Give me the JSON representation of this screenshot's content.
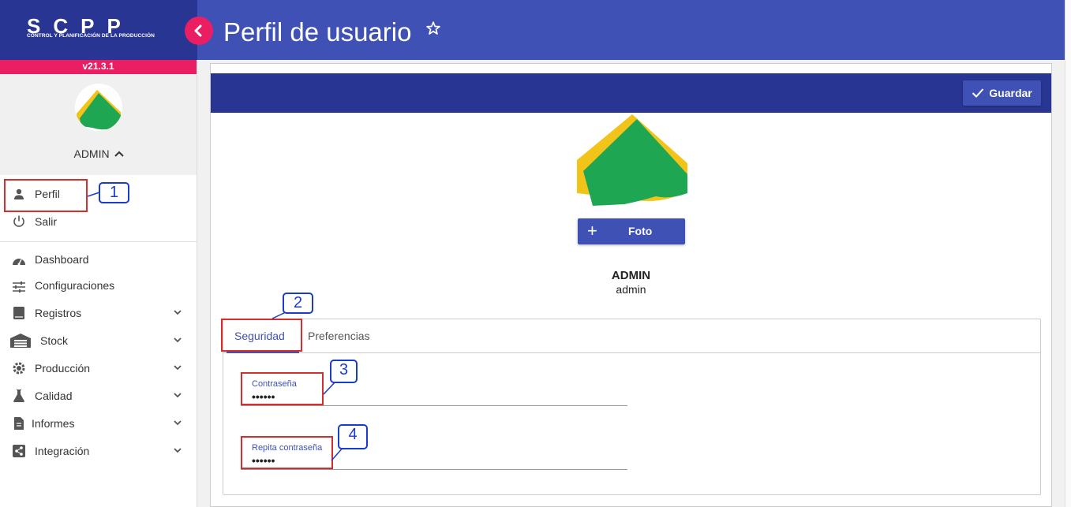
{
  "app": {
    "logo": "SCPP",
    "logo_sub": "CONTROL Y PLANIFICACIÓN DE LA PRODUCCIÓN",
    "version": "v21.3.1",
    "page_title": "Perfil de usuario",
    "accent": "#e91e63",
    "primary": "#3f51b5",
    "primary_dark": "#283593"
  },
  "sidebar": {
    "user_name": "ADMIN",
    "user_items": [
      {
        "label": "Perfil",
        "icon": "person-icon"
      },
      {
        "label": "Salir",
        "icon": "power-icon"
      }
    ],
    "nav_items": [
      {
        "label": "Dashboard",
        "icon": "speedometer-icon"
      },
      {
        "label": "Configuraciones",
        "icon": "sliders-icon"
      },
      {
        "label": "Registros",
        "icon": "book-icon"
      },
      {
        "label": "Stock",
        "icon": "warehouse-icon"
      },
      {
        "label": "Producción",
        "icon": "gear-icon"
      },
      {
        "label": "Calidad",
        "icon": "flask-icon"
      },
      {
        "label": "Informes",
        "icon": "document-icon"
      },
      {
        "label": "Integración",
        "icon": "share-icon"
      }
    ]
  },
  "main": {
    "save_label": "Guardar",
    "photo_label": "Foto",
    "display_name": "ADMIN",
    "username": "admin",
    "tabs": [
      {
        "label": "Seguridad",
        "active": true
      },
      {
        "label": "Preferencias",
        "active": false
      }
    ],
    "fields": [
      {
        "label": "Contraseña",
        "value": "••••••"
      },
      {
        "label": "Repita contraseña",
        "value": "••••••"
      }
    ]
  },
  "annotations": [
    "1",
    "2",
    "3",
    "4"
  ]
}
